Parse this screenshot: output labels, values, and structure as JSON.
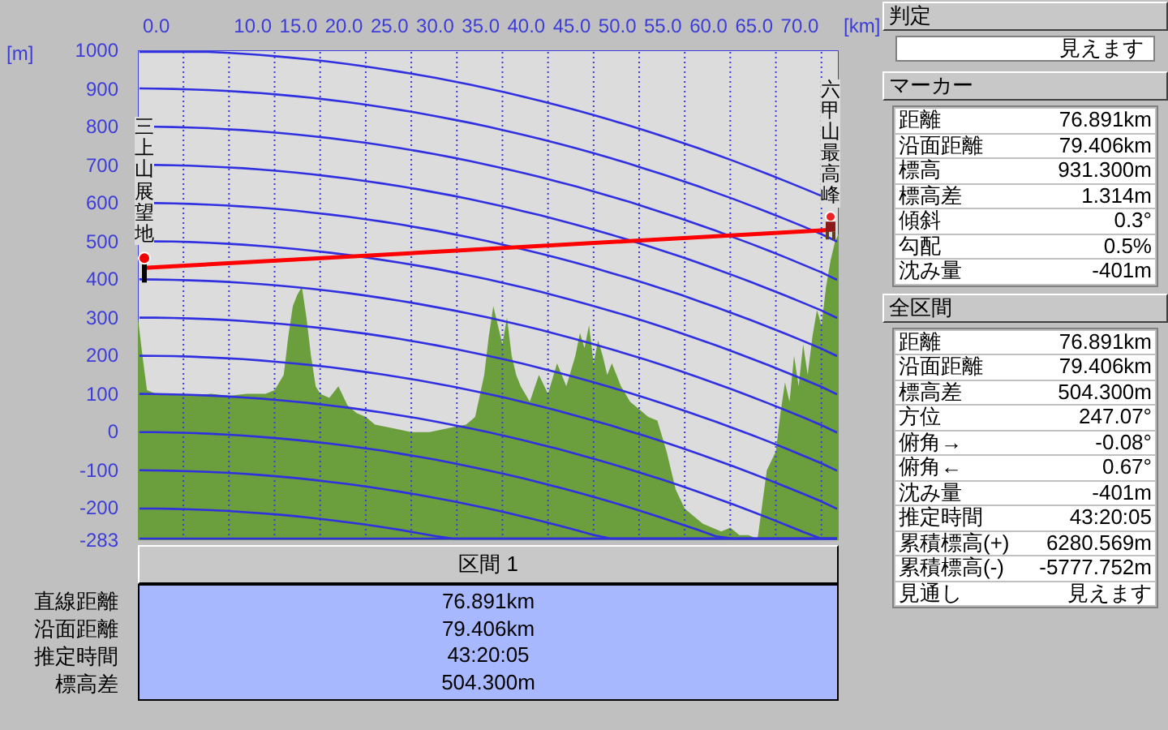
{
  "profile": {
    "x_unit": "[km]",
    "y_unit": "[m]",
    "x_labels": [
      "0.0",
      "10.0",
      "15.0",
      "20.0",
      "25.0",
      "30.0",
      "35.0",
      "40.0",
      "45.0",
      "50.0",
      "55.0",
      "60.0",
      "65.0",
      "70.0"
    ],
    "y_labels": [
      "1000",
      "900",
      "800",
      "700",
      "600",
      "500",
      "400",
      "300",
      "200",
      "100",
      "0",
      "-100",
      "-200",
      "-283"
    ],
    "start_label": "三上山展望地",
    "end_label": "六甲山最高峰"
  },
  "section": {
    "title": "区間 1",
    "rows": [
      {
        "label": "直線距離",
        "value": "76.891km"
      },
      {
        "label": "沿面距離",
        "value": "79.406km"
      },
      {
        "label": "推定時間",
        "value": "43:20:05"
      },
      {
        "label": "標高差",
        "value": "504.300m"
      }
    ]
  },
  "judgement": {
    "title": "判定",
    "value": "見えます"
  },
  "marker": {
    "title": "マーカー",
    "rows": [
      {
        "label": "距離",
        "value": "76.891km"
      },
      {
        "label": "沿面距離",
        "value": "79.406km"
      },
      {
        "label": "標高",
        "value": "931.300m"
      },
      {
        "label": "標高差",
        "value": "1.314m"
      },
      {
        "label": "傾斜",
        "value": "0.3°"
      },
      {
        "label": "勾配",
        "value": "0.5%"
      },
      {
        "label": "沈み量",
        "value": "-401m"
      }
    ]
  },
  "whole_route": {
    "title": "全区間",
    "rows": [
      {
        "label": "距離",
        "value": "76.891km"
      },
      {
        "label": "沿面距離",
        "value": "79.406km"
      },
      {
        "label": "標高差",
        "value": "504.300m"
      },
      {
        "label": "方位",
        "value": "247.07°"
      },
      {
        "label": "俯角→",
        "value": "-0.08°"
      },
      {
        "label": "俯角←",
        "value": "0.67°"
      },
      {
        "label": "沈み量",
        "value": "-401m"
      },
      {
        "label": "推定時間",
        "value": "43:20:05"
      },
      {
        "label": "累積標高(+)",
        "value": "6280.569m"
      },
      {
        "label": "累積標高(-)",
        "value": "-5777.752m"
      },
      {
        "label": "見通し",
        "value": "見えます"
      }
    ]
  }
}
